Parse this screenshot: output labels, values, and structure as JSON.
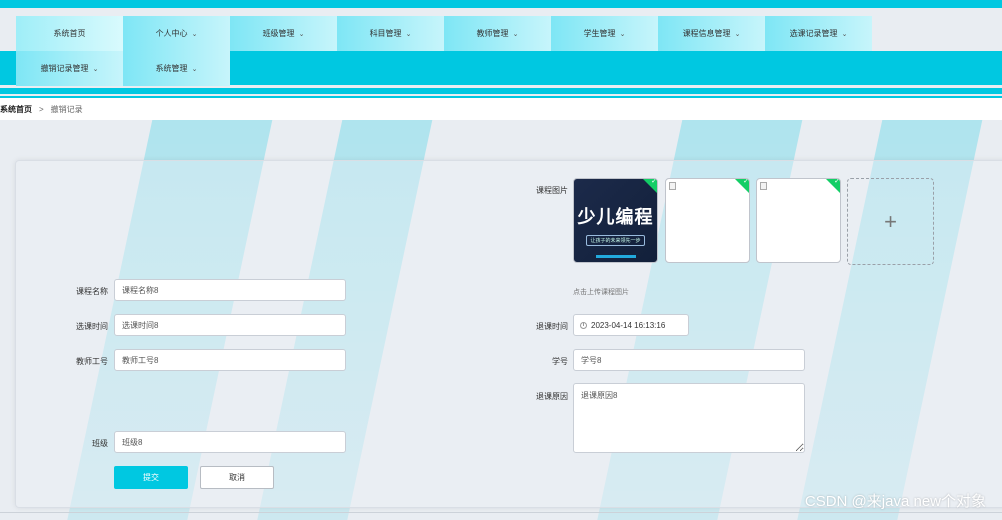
{
  "nav": {
    "items": [
      {
        "label": "系统首页",
        "dropdown": false
      },
      {
        "label": "个人中心",
        "dropdown": true
      },
      {
        "label": "班级管理",
        "dropdown": true
      },
      {
        "label": "科目管理",
        "dropdown": true
      },
      {
        "label": "教师管理",
        "dropdown": true
      },
      {
        "label": "学生管理",
        "dropdown": true
      },
      {
        "label": "课程信息管理",
        "dropdown": true
      },
      {
        "label": "选课记录管理",
        "dropdown": true
      },
      {
        "label": "撤销记录管理",
        "dropdown": true
      },
      {
        "label": "系统管理",
        "dropdown": true
      }
    ],
    "chevron": "⌄"
  },
  "breadcrumb": {
    "home": "系统首页",
    "separator": ">",
    "current": "撤销记录"
  },
  "form": {
    "course_name": {
      "label": "课程名称",
      "value": "课程名称8"
    },
    "select_time": {
      "label": "选课时间",
      "value": "选课时间8"
    },
    "teacher_id": {
      "label": "教师工号",
      "value": "教师工号8"
    },
    "class": {
      "label": "班级",
      "value": "班级8"
    },
    "course_image": {
      "label": "课程图片",
      "hint": "点击上传课程图片",
      "thumb_title": "少儿编程",
      "thumb_subtitle": "让孩子的未来领先一步"
    },
    "withdraw_time": {
      "label": "退课时间",
      "value": "2023-04-14 16:13:16"
    },
    "student_id": {
      "label": "学号",
      "value": "学号8"
    },
    "withdraw_reason": {
      "label": "退课原因",
      "value": "退课原因8"
    },
    "submit_label": "提交",
    "cancel_label": "取消"
  },
  "watermark": "CSDN @来java new个对象",
  "colors": {
    "accent": "#00c8e1",
    "success": "#13ce66"
  }
}
